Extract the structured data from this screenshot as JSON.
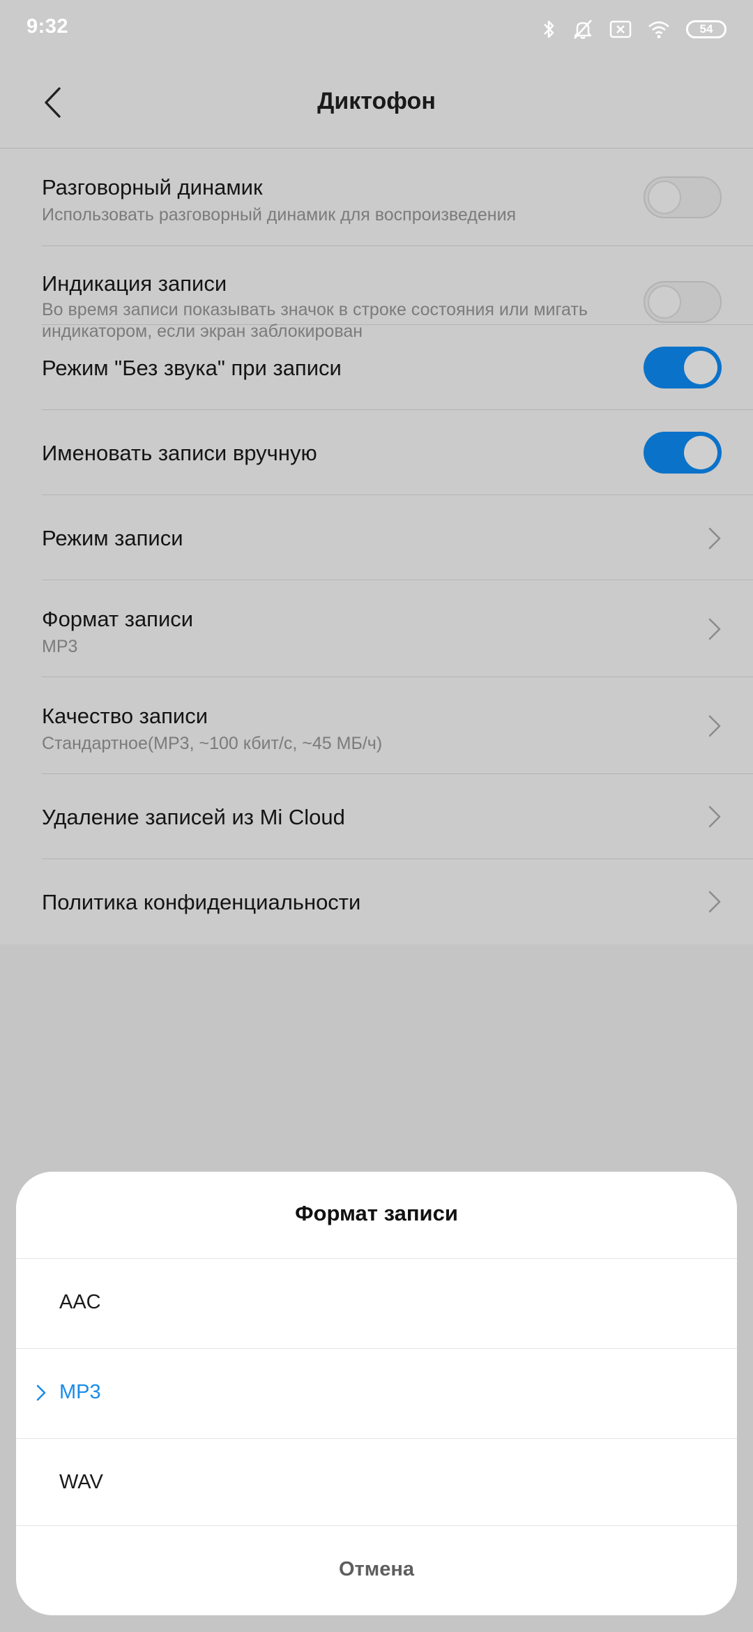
{
  "status_bar": {
    "time": "9:32",
    "battery": "54",
    "icons": [
      "bluetooth-icon",
      "muted-bell-icon",
      "sim-x-icon",
      "wifi-icon",
      "battery-icon"
    ]
  },
  "header": {
    "title": "Диктофон",
    "back_icon": "chevron-left-icon"
  },
  "settings": [
    {
      "title": "Разговорный динамик",
      "subtitle": "Использовать разговорный динамик для воспроизведения",
      "control": "toggle",
      "on": false
    },
    {
      "title": "Индикация записи",
      "subtitle": "Во время записи показывать значок в строке состояния или мигать индикатором, если экран заблокирован",
      "control": "toggle",
      "on": false
    },
    {
      "title": "Режим \"Без звука\" при записи",
      "subtitle": "",
      "control": "toggle",
      "on": true
    },
    {
      "title": "Именовать записи вручную",
      "subtitle": "",
      "control": "toggle",
      "on": true
    },
    {
      "title": "Режим записи",
      "subtitle": "",
      "control": "chevron"
    },
    {
      "title": "Формат записи",
      "subtitle": "MP3",
      "control": "chevron"
    },
    {
      "title": "Качество записи",
      "subtitle": "Стандартное(MP3, ~100 кбит/с, ~45 МБ/ч)",
      "control": "chevron"
    },
    {
      "title": "Удаление записей из Mi Cloud",
      "subtitle": "",
      "control": "chevron"
    },
    {
      "title": "Политика конфиденциальности",
      "subtitle": "",
      "control": "chevron"
    }
  ],
  "sheet": {
    "title": "Формат записи",
    "options": [
      {
        "label": "AAC",
        "selected": false
      },
      {
        "label": "MP3",
        "selected": true
      },
      {
        "label": "WAV",
        "selected": false
      }
    ],
    "cancel_label": "Отмена"
  },
  "colors": {
    "accent": "#0b72c9",
    "selected_text": "#1a8ce8",
    "dim_background": "#c5c5c5"
  }
}
